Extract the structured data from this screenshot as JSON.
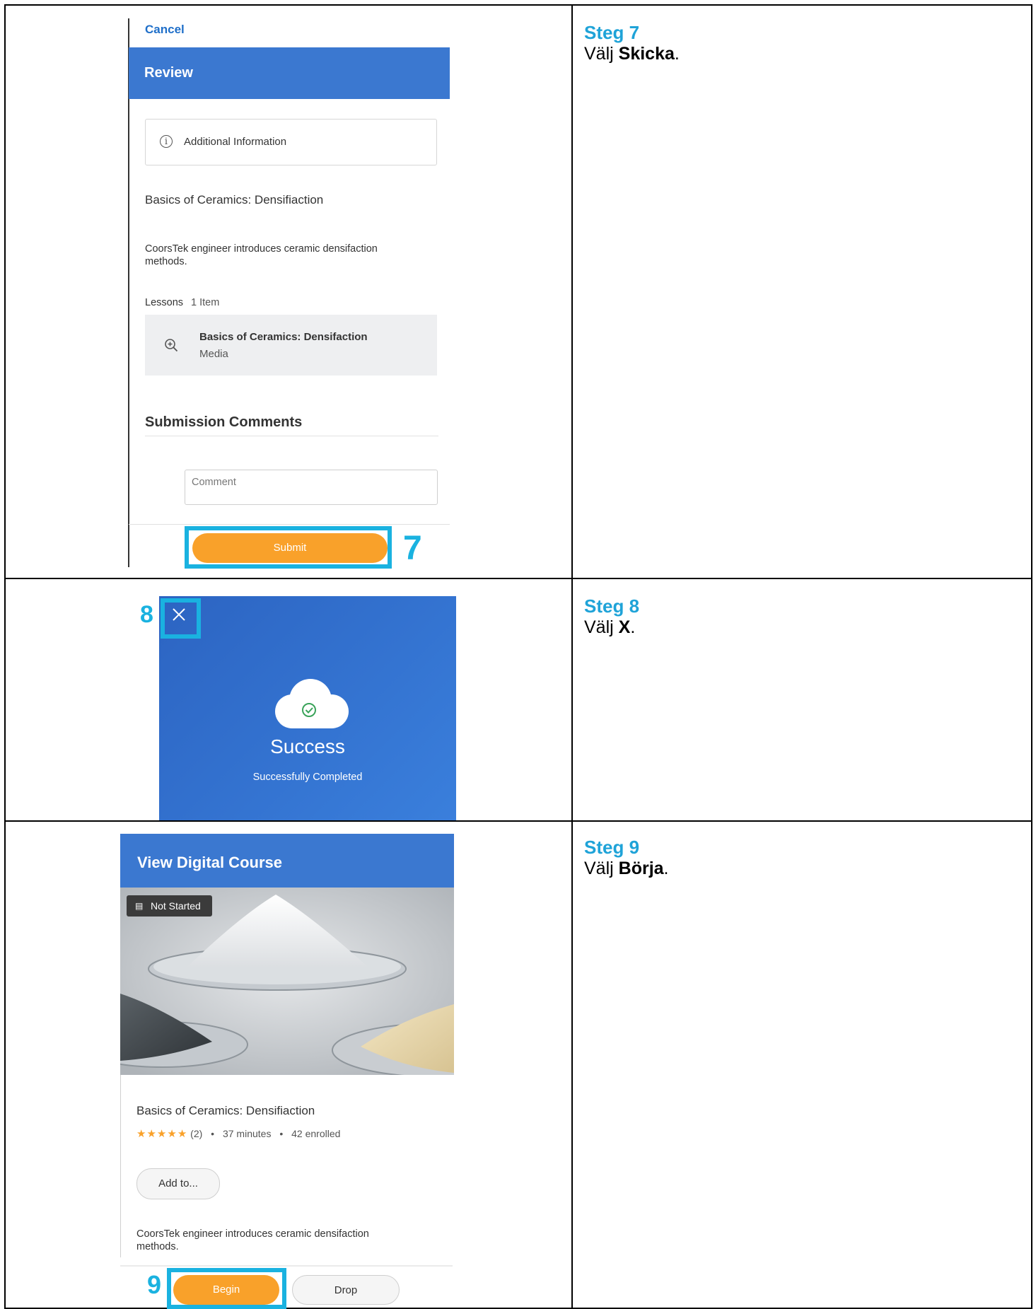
{
  "steps": [
    {
      "title": "Steg 7",
      "desc_prefix": "Välj ",
      "desc_bold": "Skicka",
      "desc_suffix": "."
    },
    {
      "title": "Steg 8",
      "desc_prefix": "Välj ",
      "desc_bold": "X",
      "desc_suffix": "."
    },
    {
      "title": "Steg 9",
      "desc_prefix": "Välj ",
      "desc_bold": "Börja",
      "desc_suffix": "."
    }
  ],
  "callouts": [
    "7",
    "8",
    "9"
  ],
  "review": {
    "cancel": "Cancel",
    "header": "Review",
    "info_label": "Additional Information",
    "info_icon": "info-icon",
    "course_title": "Basics of Ceramics: Densifiaction",
    "course_desc": "CoorsTek engineer introduces ceramic densifaction methods.",
    "lessons_label": "Lessons",
    "lessons_count": "1 Item",
    "lesson_name": "Basics of Ceramics: Densifaction",
    "lesson_type": "Media",
    "lesson_icon": "zoom-in-icon",
    "submission_heading": "Submission Comments",
    "comment_placeholder": "Comment",
    "submit_label": "Submit"
  },
  "success": {
    "title": "Success",
    "subtitle": "Successfully Completed",
    "close_icon": "close-icon",
    "cloud_icon": "cloud-check-icon"
  },
  "course": {
    "header": "View Digital Course",
    "badge_icon": "presentation-icon",
    "badge": "Not Started",
    "title": "Basics of Ceramics: Densifiaction",
    "rating_stars": 5,
    "rating_count": "(2)",
    "duration": "37 minutes",
    "enrolled": "42 enrolled",
    "add_to": "Add to...",
    "desc": "CoorsTek engineer introduces ceramic densifaction methods.",
    "begin_label": "Begin",
    "drop_label": "Drop"
  },
  "colors": {
    "accent_blue": "#3b78d0",
    "highlight_cyan": "#1ab2e0",
    "step_title": "#1fa3d8",
    "button_orange": "#f9a12a"
  }
}
